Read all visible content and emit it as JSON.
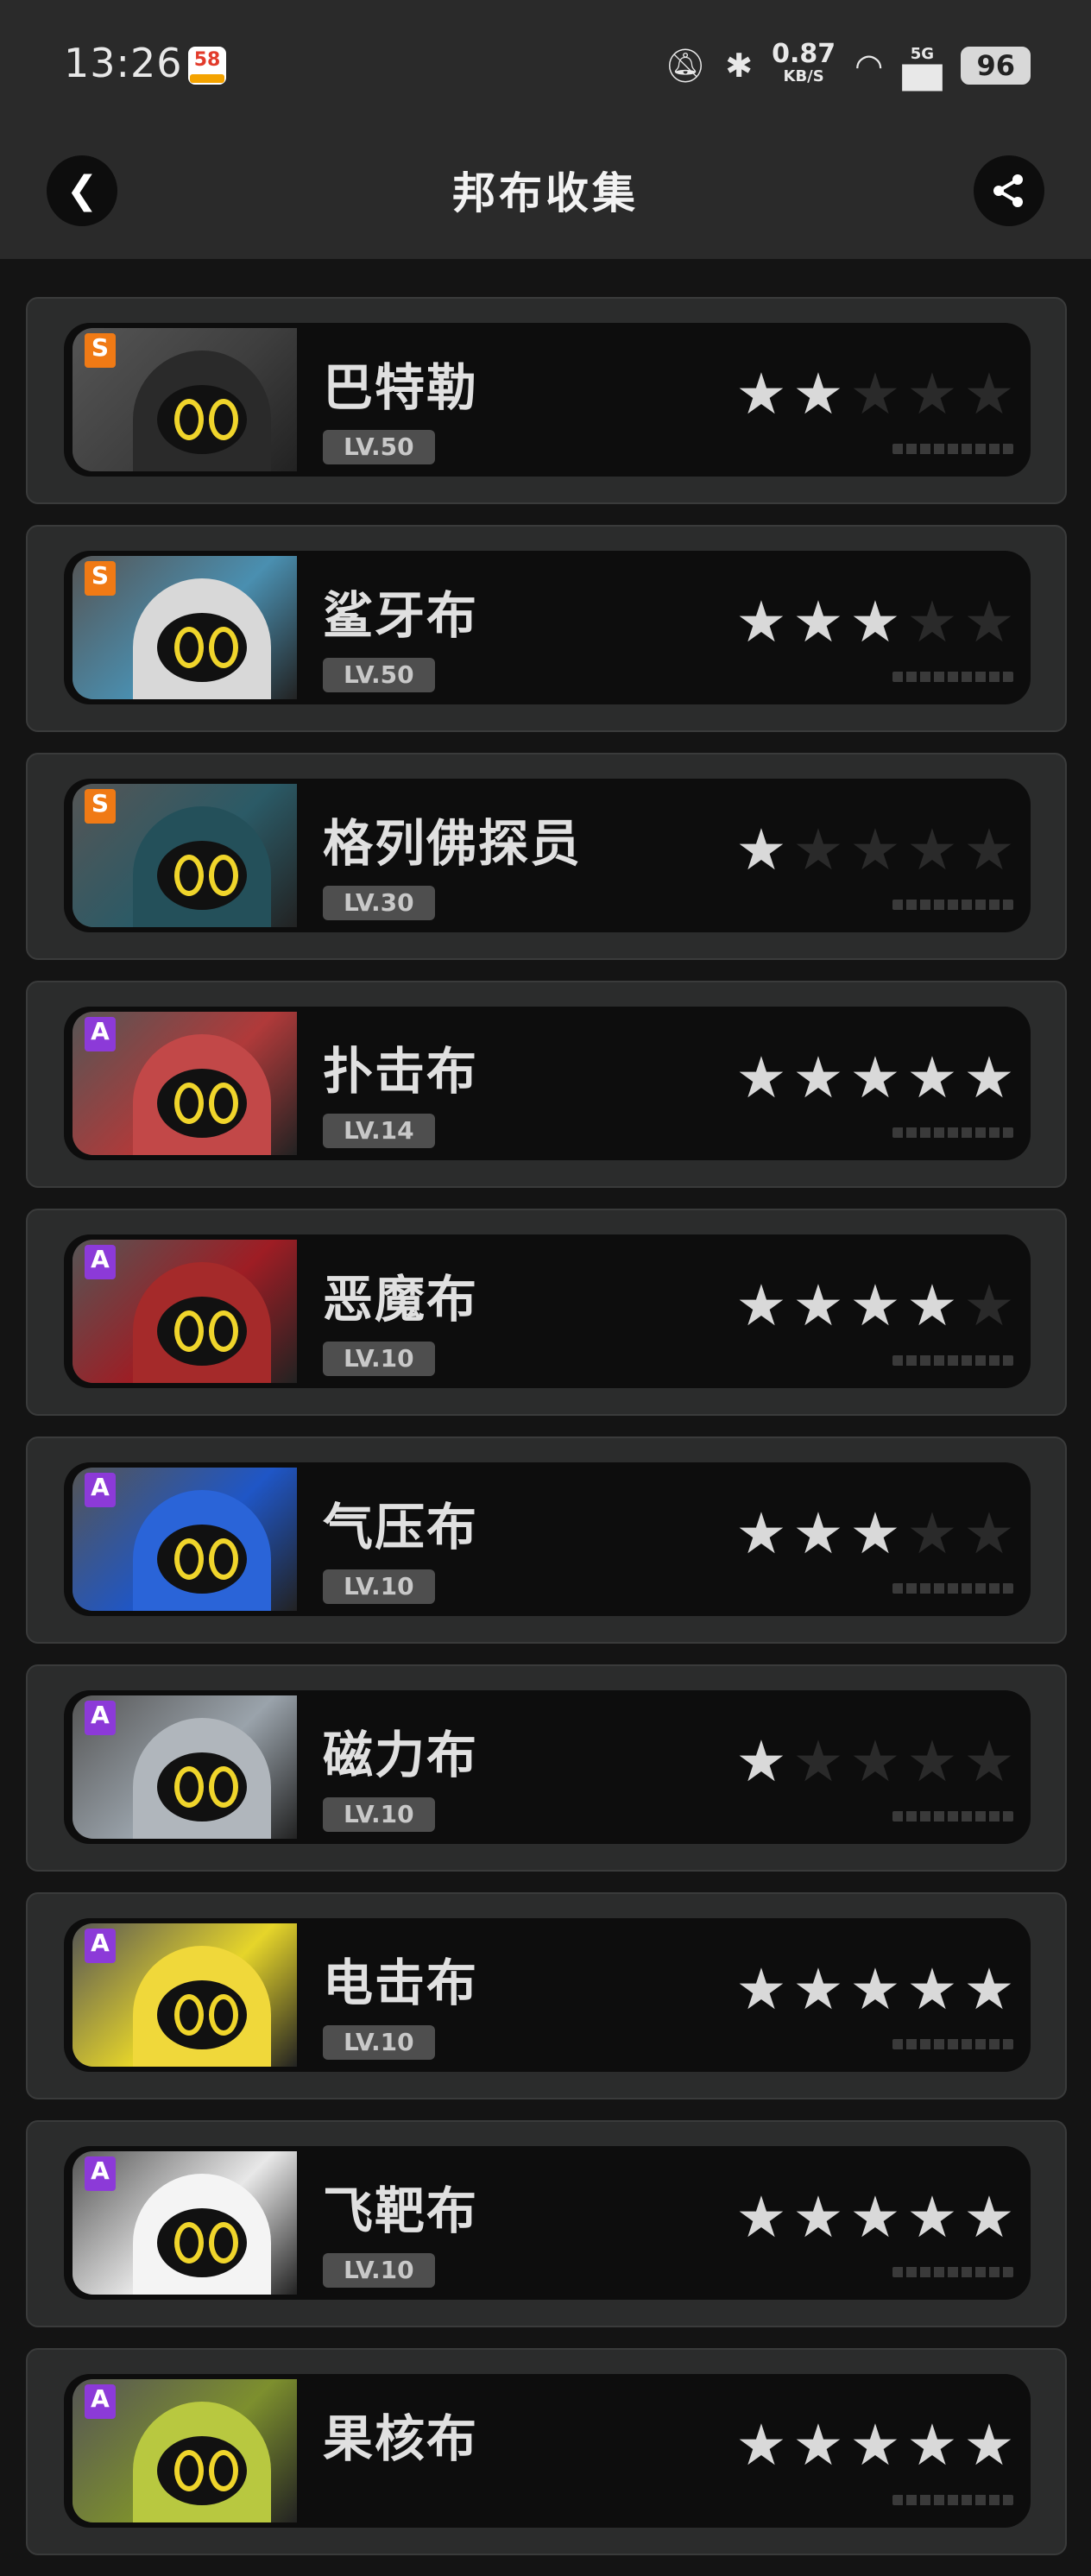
{
  "status_bar": {
    "time": "13:26",
    "app_icon": "58",
    "speed_value": "0.87",
    "speed_unit": "KB/S",
    "network": "5G",
    "battery": "96"
  },
  "header": {
    "title": "邦布收集",
    "back_icon": "chevron-left-icon",
    "share_icon": "share-icon"
  },
  "colors": {
    "rank_s": "#f07a15",
    "rank_a": "#8c3ad8",
    "star_on": "#d9d9d9",
    "star_off": "#2a2a2a"
  },
  "bangboo": [
    {
      "name": "巴特勒",
      "level": "LV.50",
      "rank": "S",
      "stars": 2
    },
    {
      "name": "鲨牙布",
      "level": "LV.50",
      "rank": "S",
      "stars": 3
    },
    {
      "name": "格列佛探员",
      "level": "LV.30",
      "rank": "S",
      "stars": 1
    },
    {
      "name": "扑击布",
      "level": "LV.14",
      "rank": "A",
      "stars": 5
    },
    {
      "name": "恶魔布",
      "level": "LV.10",
      "rank": "A",
      "stars": 4
    },
    {
      "name": "气压布",
      "level": "LV.10",
      "rank": "A",
      "stars": 3
    },
    {
      "name": "磁力布",
      "level": "LV.10",
      "rank": "A",
      "stars": 1
    },
    {
      "name": "电击布",
      "level": "LV.10",
      "rank": "A",
      "stars": 5
    },
    {
      "name": "飞靶布",
      "level": "LV.10",
      "rank": "A",
      "stars": 5
    },
    {
      "name": "果核布",
      "level": "",
      "rank": "A",
      "stars": 5
    }
  ]
}
